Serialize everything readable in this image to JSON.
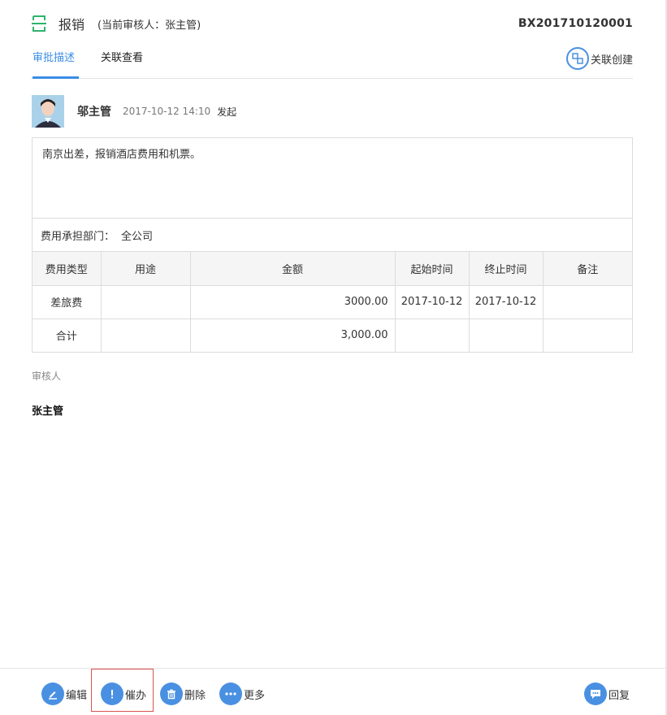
{
  "header": {
    "title": "报销",
    "current_reviewer": "(当前审核人：张主管)",
    "code": "BX201710120001"
  },
  "tabs": [
    {
      "label": "审批描述"
    },
    {
      "label": "关联查看"
    }
  ],
  "link_create": {
    "label": "关联创建"
  },
  "author": {
    "name": "邬主管",
    "time": "2017-10-12 14:10",
    "action": "发起"
  },
  "description": "南京出差，报销酒店费用和机票。",
  "dept": {
    "label": "费用承担部门：",
    "value": "全公司"
  },
  "table": {
    "headers": [
      "费用类型",
      "用途",
      "金额",
      "起始时间",
      "终止时间",
      "备注"
    ],
    "rows": [
      [
        "差旅费",
        "",
        "3000.00",
        "2017-10-12",
        "2017-10-12",
        ""
      ],
      [
        "合计",
        "",
        "3,000.00",
        "",
        "",
        ""
      ]
    ]
  },
  "reviewers": {
    "label": "审核人",
    "name": "张主管"
  },
  "footer": {
    "edit": "编辑",
    "urge": "催办",
    "delete": "删除",
    "more": "更多",
    "reply": "回复"
  },
  "colors": {
    "accent": "#3a8ee6",
    "icon_bg": "#4a90e2",
    "highlight_border": "#d9534f"
  }
}
